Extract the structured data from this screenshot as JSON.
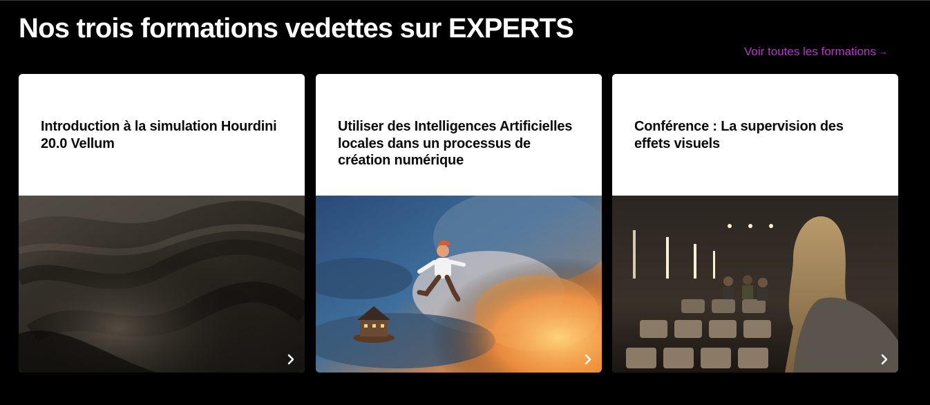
{
  "section": {
    "title": "Nos trois formations vedettes sur EXPERTS",
    "see_all_label": "Voir toutes les formations",
    "see_all_arrow": "→",
    "accent_color": "#c12fd8"
  },
  "cards": [
    {
      "title": "Introduction à la simulation Hourdini 20.0 Vellum",
      "image": "dark-fabric-cloth-image",
      "icon": "chevron-right-icon"
    },
    {
      "title": "Utiliser des Intelligences Artificielles locales dans un processus de création numérique",
      "image": "flying-scientist-clouds-image",
      "icon": "chevron-right-icon"
    },
    {
      "title": "Conférence : La supervision des effets visuels",
      "image": "conference-theater-image",
      "icon": "chevron-right-icon"
    }
  ]
}
